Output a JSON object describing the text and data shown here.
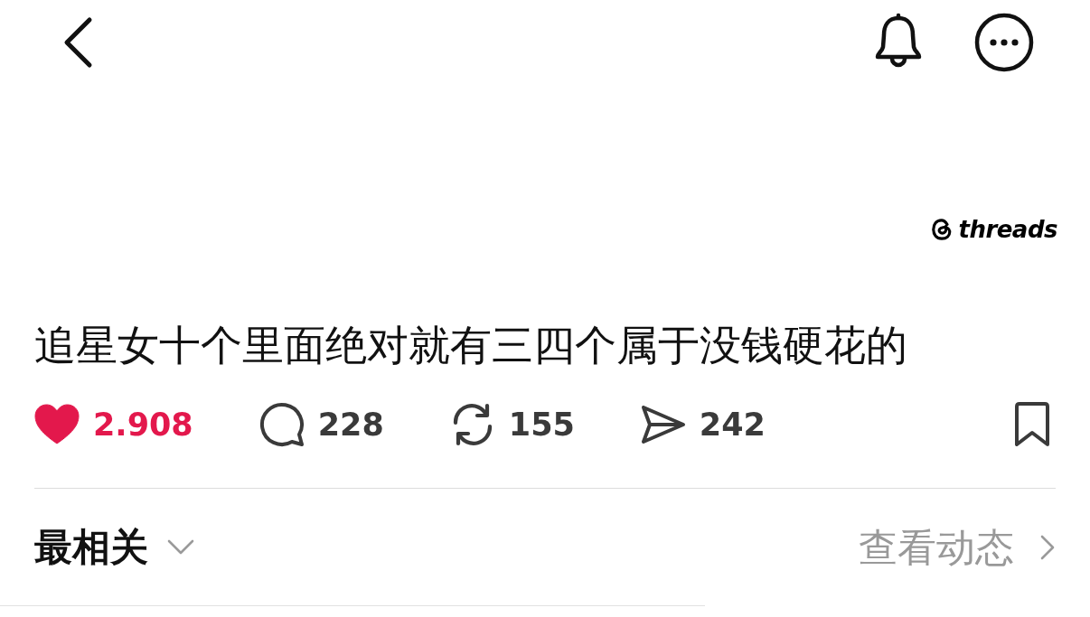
{
  "logo": {
    "text": "threads"
  },
  "post": {
    "text": "追星女十个里面绝对就有三四个属于没钱硬花的"
  },
  "actions": [
    {
      "kind": "like",
      "count": "2.908",
      "active": true
    },
    {
      "kind": "comment",
      "count": "228",
      "active": false
    },
    {
      "kind": "repost",
      "count": "155",
      "active": false
    },
    {
      "kind": "share",
      "count": "242",
      "active": false
    }
  ],
  "bookmark": {
    "saved": false
  },
  "sort": {
    "label": "最相关"
  },
  "activity_link": {
    "label": "查看动态"
  }
}
